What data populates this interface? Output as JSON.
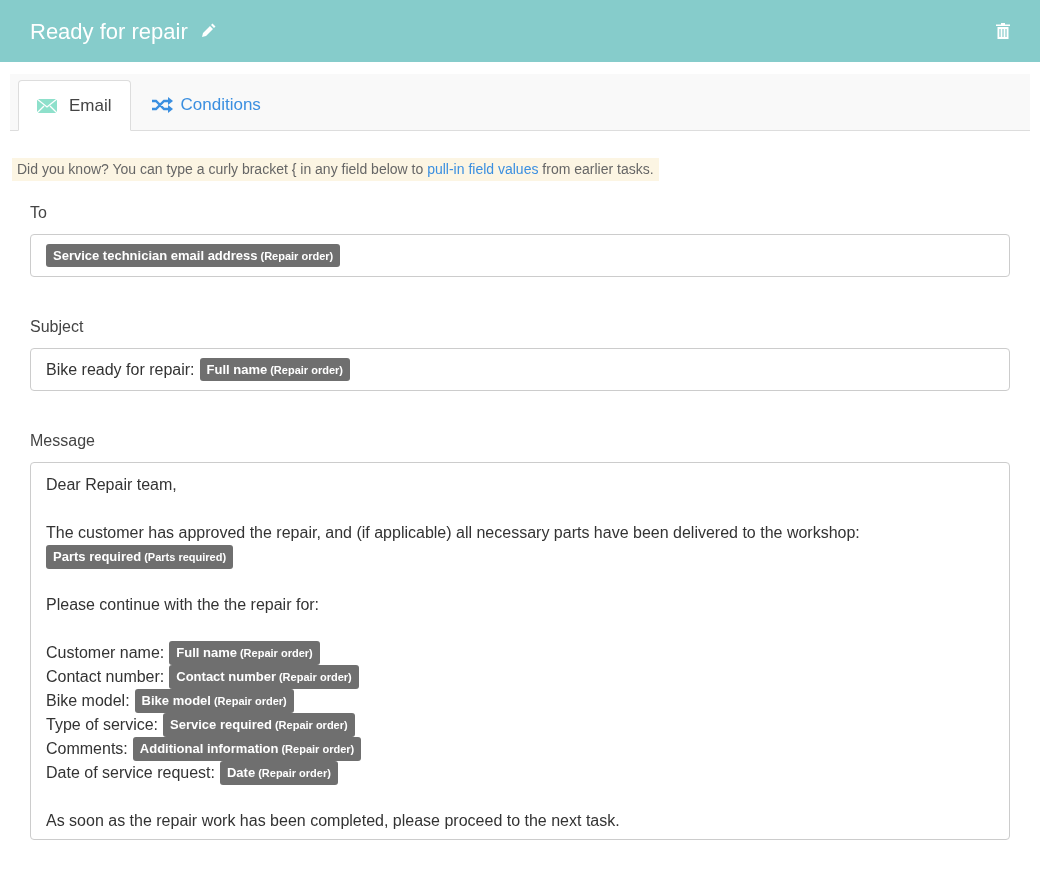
{
  "header": {
    "title": "Ready for repair"
  },
  "tabs": [
    {
      "label": "Email",
      "kind": "email",
      "selected": true
    },
    {
      "label": "Conditions",
      "kind": "conditions",
      "selected": false
    }
  ],
  "hint": {
    "before": "Did you know? You can type a curly bracket { in any field below to",
    "link": "pull-in field values",
    "after": "from earlier tasks."
  },
  "fields": [
    {
      "label": "To",
      "kind": "single",
      "content": [
        {
          "kind": "token",
          "name": "Service technician email address",
          "source": "(Repair order)"
        }
      ]
    },
    {
      "label": "Subject",
      "kind": "single",
      "content": [
        {
          "kind": "text",
          "text": "Bike ready for repair:"
        },
        {
          "kind": "token",
          "name": "Full name",
          "source": "(Repair order)"
        }
      ]
    },
    {
      "label": "Message",
      "kind": "multi",
      "paragraphs": [
        [
          [
            {
              "kind": "text",
              "text": "Dear Repair team,"
            }
          ]
        ],
        [
          [
            {
              "kind": "text",
              "text": "The customer has approved the repair, and (if applicable) all necessary parts have been delivered to the workshop:"
            }
          ],
          [
            {
              "kind": "token",
              "name": "Parts required",
              "source": "(Parts required)"
            }
          ]
        ],
        [
          [
            {
              "kind": "text",
              "text": "Please continue with the the repair for:"
            }
          ]
        ],
        [
          [
            {
              "kind": "text",
              "text": "Customer name:"
            },
            {
              "kind": "token",
              "name": "Full name",
              "source": "(Repair order)"
            }
          ],
          [
            {
              "kind": "text",
              "text": "Contact number:"
            },
            {
              "kind": "token",
              "name": "Contact number",
              "source": "(Repair order)"
            }
          ],
          [
            {
              "kind": "text",
              "text": "Bike model:"
            },
            {
              "kind": "token",
              "name": "Bike model",
              "source": "(Repair order)"
            }
          ],
          [
            {
              "kind": "text",
              "text": "Type of service:"
            },
            {
              "kind": "token",
              "name": "Service required",
              "source": "(Repair order)"
            }
          ],
          [
            {
              "kind": "text",
              "text": "Comments:"
            },
            {
              "kind": "token",
              "name": "Additional information",
              "source": "(Repair order)"
            }
          ],
          [
            {
              "kind": "text",
              "text": "Date of service request:"
            },
            {
              "kind": "token",
              "name": "Date",
              "source": "(Repair order)"
            }
          ]
        ],
        [
          [
            {
              "kind": "text",
              "text": "As soon as the repair work has been completed, please proceed to the next task."
            }
          ]
        ]
      ]
    }
  ]
}
